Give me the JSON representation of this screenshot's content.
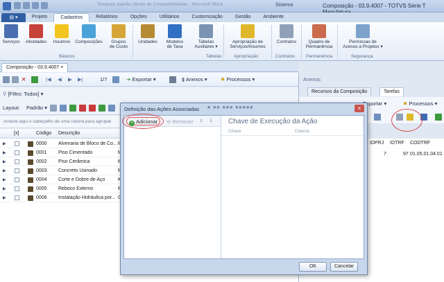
{
  "titlebar": {
    "blurred_text": "Template padrão (Modo de Compatibilidade) - Microsoft Word",
    "system_label": "Sistema",
    "window_title": "Composição - 03.9.4007 - TOTVS Série T Manufatura"
  },
  "ribbon_tabs": [
    "Projeto",
    "Cadastros",
    "Relatórios",
    "Opções",
    "Utilitários",
    "Customização",
    "Gestão",
    "Ambiente"
  ],
  "ribbon": {
    "buttons": [
      {
        "label": "Serviços",
        "color": "#4a6fb0"
      },
      {
        "label": "Atividades",
        "color": "#c7423b"
      },
      {
        "label": "Insumos",
        "color": "#f2c521"
      },
      {
        "label": "Composições",
        "color": "#4aa3d8"
      },
      {
        "label": "Grupos\nde Custo",
        "color": "#d6a53a"
      },
      {
        "label": "Unidades",
        "color": "#b78a34"
      },
      {
        "label": "Modelos\nde Taxa",
        "color": "#2f6fc4"
      },
      {
        "label": "Tabelas\nAuxiliares ▾",
        "color": "#7c93b4"
      },
      {
        "label": "Apropriação de\nServiços/Insumos",
        "color": "#e0b72b"
      },
      {
        "label": "Contratos",
        "color": "#8fa0b8"
      },
      {
        "label": "Quadro de\nPermanência",
        "color": "#c96b4c"
      },
      {
        "label": "Permissao de\nAcesso a Projetos ▾",
        "color": "#7da2cc"
      }
    ],
    "groups": [
      "Básicos",
      "Tabelas",
      "Apropriação",
      "Contratos",
      "Permanência",
      "Segurança"
    ]
  },
  "doc_tab": "Composição - 03.9.4007",
  "toolbar": {
    "pager": "1/7",
    "export": "Exportar",
    "annexes": "Anexos",
    "processes": "Processos",
    "filter": "[Filtro: Todos]",
    "layout_label": "Layout:",
    "layout_value": "Padrão"
  },
  "grid": {
    "group_hint": "Arraste aqui o cabeçalho de uma coluna para agrupar",
    "headers": [
      "[x]",
      "Código",
      "Descrição"
    ],
    "rows": [
      {
        "code": "0000",
        "desc": "Alvenaria de Bloco de Co...",
        "extra": "M"
      },
      {
        "code": "0001",
        "desc": "Piso Cimentado",
        "extra": "M"
      },
      {
        "code": "0002",
        "desc": "Piso Cerâmica",
        "extra": "M"
      },
      {
        "code": "0003",
        "desc": "Concreto Usinado",
        "extra": "M"
      },
      {
        "code": "0004",
        "desc": "Corte e Dobre de Aço",
        "extra": "K"
      },
      {
        "code": "0005",
        "desc": "Reboco Externo",
        "extra": "M"
      },
      {
        "code": "0006",
        "desc": "Instalação Hidráulica por...",
        "extra": "G"
      }
    ]
  },
  "annex": {
    "title": "Anexos",
    "tabs": [
      "Recursos da Composição",
      "Tarefas"
    ],
    "export": "Exportar",
    "processes": "Processos",
    "headers": [
      "IDPRJ",
      "IDTRF",
      "CODTRF"
    ],
    "values": [
      "7",
      "97",
      "01.05.01.04.01"
    ]
  },
  "dialog": {
    "title": "Definição das Ações Associadas",
    "blurred": "■ ■■ ■■■ ■■■■■",
    "add": "Adicionar",
    "remove": "Remover",
    "right_title": "Chave de Execução da Ação",
    "right_headers": [
      "Chave",
      "Coluna"
    ],
    "ok": "OK",
    "cancel": "Cancelar"
  }
}
